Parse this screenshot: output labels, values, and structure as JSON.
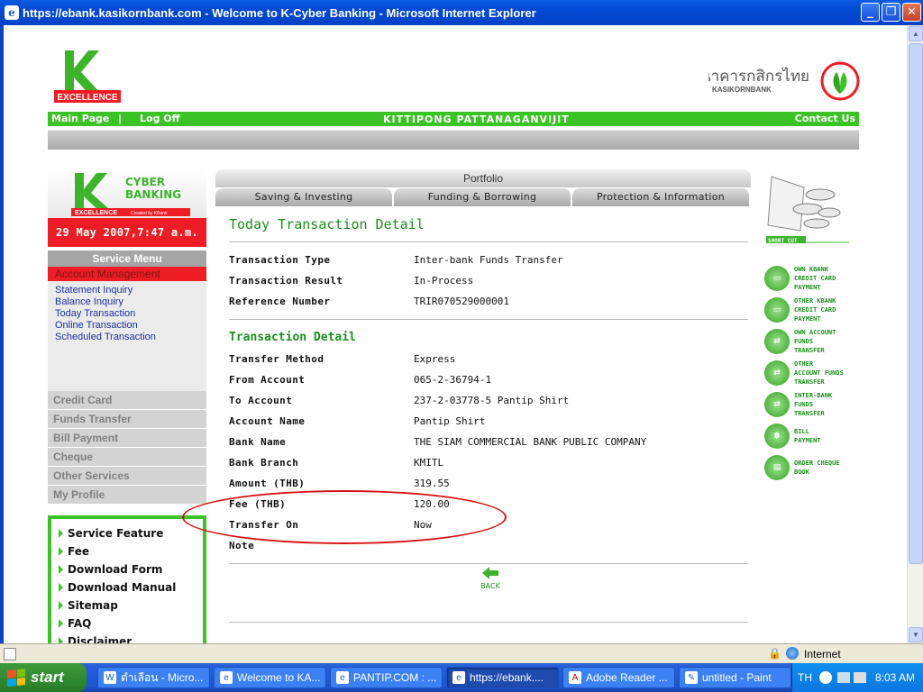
{
  "window": {
    "title": "https://ebank.kasikornbank.com - Welcome to K-Cyber Banking - Microsoft Internet Explorer"
  },
  "header": {
    "k_logo_caption": "EXCELLENCE",
    "bank_name_thai": "ธนาคารกสิกรไทย",
    "bank_name_en": "KASIKORNBANK",
    "nav_main_page": "Main Page",
    "nav_log_off": "Log Off",
    "user_name": "KITTIPONG PATTANAGANVIJIT",
    "nav_contact": "Contact Us"
  },
  "sidebar": {
    "cyber_logo_line1": "CYBER",
    "cyber_logo_line2": "BANKING",
    "cyber_logo_caption": "EXCELLENCE",
    "cyber_logo_sub": "Created by KBank",
    "datetime": "29 May 2007,7:47 a.m.",
    "service_menu_title": "Service Menu",
    "active_item": "Account Management",
    "sub_items": [
      "Statement Inquiry",
      "Balance Inquiry",
      "Today Transaction",
      "Online Transaction",
      "Scheduled Transaction"
    ],
    "menu_items": [
      "Credit Card",
      "Funds Transfer",
      "Bill Payment",
      "Cheque",
      "Other Services",
      "My Profile"
    ],
    "links": [
      "Service Feature",
      "Fee",
      "Download Form",
      "Download Manual",
      "Sitemap",
      "FAQ",
      "Disclaimer"
    ]
  },
  "tabs": {
    "portfolio": "Portfolio",
    "items": [
      "Saving & Investing",
      "Funding & Borrowing",
      "Protection & Information"
    ]
  },
  "detail": {
    "title": "Today Transaction Detail",
    "summary": [
      {
        "label": "Transaction Type",
        "value": "Inter-bank Funds Transfer"
      },
      {
        "label": "Transaction Result",
        "value": "In-Process"
      },
      {
        "label": "Reference Number",
        "value": "TRIR070529000001"
      }
    ],
    "section_title": "Transaction Detail",
    "rows": [
      {
        "label": "Transfer Method",
        "value": "Express"
      },
      {
        "label": "From Account",
        "value": "065-2-36794-1"
      },
      {
        "label": "To Account",
        "value": "237-2-03778-5 Pantip Shirt"
      },
      {
        "label": "Account Name",
        "value": "Pantip Shirt"
      },
      {
        "label": "Bank Name",
        "value": "THE SIAM COMMERCIAL BANK PUBLIC COMPANY"
      },
      {
        "label": "Bank Branch",
        "value": "KMITL"
      },
      {
        "label": "Amount (THB)",
        "value": "319.55"
      },
      {
        "label": "Fee (THB)",
        "value": "120.00"
      },
      {
        "label": "Transfer On",
        "value": "Now"
      },
      {
        "label": "Note",
        "value": ""
      }
    ],
    "back_label": "BACK"
  },
  "shortcut": {
    "title": "SHORT CUT",
    "items": [
      {
        "line1": "OWN KBank",
        "line2": "CREDIT CARD",
        "line3": "PAYMENT"
      },
      {
        "line1": "OTHER KBank",
        "line2": "CREDIT CARD",
        "line3": "PAYMENT"
      },
      {
        "line1": "OWN ACCOUNT",
        "line2": "FUNDS",
        "line3": "TRANSFER"
      },
      {
        "line1": "OTHER",
        "line2": "ACCOUNT FUNDS",
        "line3": "TRANSFER"
      },
      {
        "line1": "INTER-BANK",
        "line2": "FUNDS",
        "line3": "TRANSFER"
      },
      {
        "line1": "BILL",
        "line2": "PAYMENT",
        "line3": ""
      },
      {
        "line1": "ORDER CHEQUE",
        "line2": "BOOK",
        "line3": ""
      }
    ]
  },
  "statusbar": {
    "zone": "Internet"
  },
  "taskbar": {
    "start": "start",
    "tasks": [
      "ตำเลือน - Micro...",
      "Welcome to KA...",
      "PANTIP.COM : ...",
      "https://ebank....",
      "Adobe Reader ...",
      "untitled - Paint"
    ],
    "lang": "TH",
    "clock": "8:03 AM"
  },
  "colors": {
    "brand_green": "#3bc226",
    "accent_red": "#ee1c25",
    "xp_blue": "#245edb"
  }
}
